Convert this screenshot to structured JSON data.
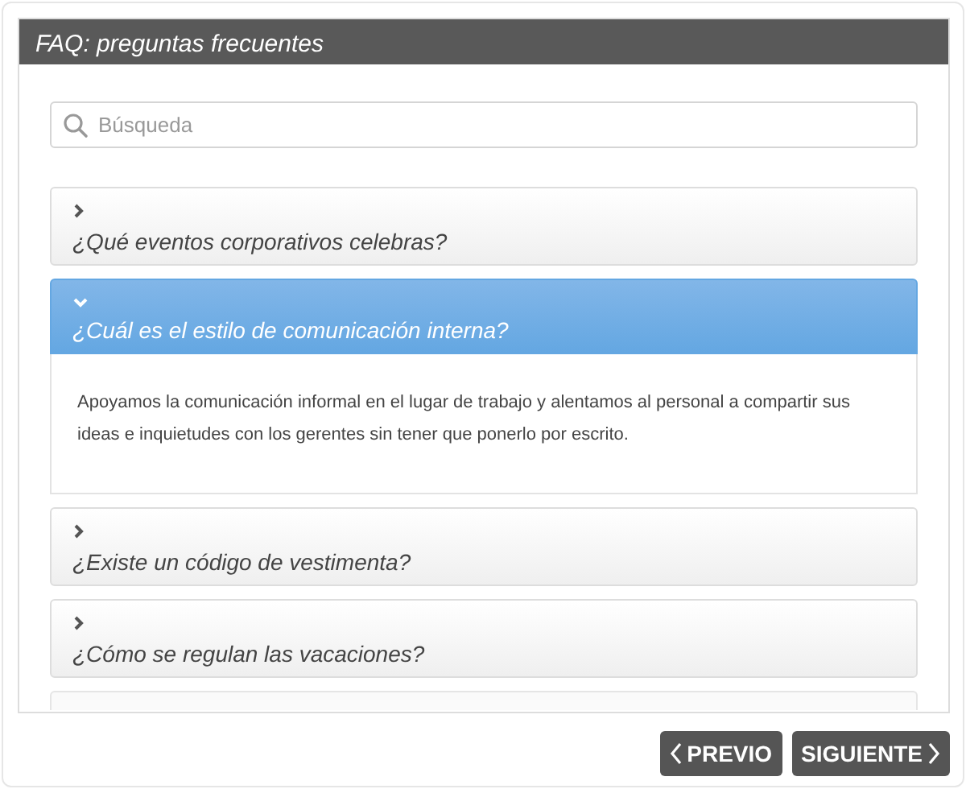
{
  "window": {
    "title": "FAQ: preguntas frecuentes"
  },
  "search": {
    "placeholder": "Búsqueda"
  },
  "faqs": [
    {
      "question": "¿Qué eventos corporativos celebras?",
      "expanded": false
    },
    {
      "question": "¿Cuál es el estilo de comunicación interna?",
      "expanded": true,
      "answer": "Apoyamos la comunicación informal en el lugar de trabajo y alentamos al personal a compartir sus ideas e inquietudes con los gerentes sin tener que ponerlo por escrito."
    },
    {
      "question": "¿Existe un código de vestimenta?",
      "expanded": false
    },
    {
      "question": "¿Cómo se regulan las vacaciones?",
      "expanded": false
    }
  ],
  "buttons": [
    {
      "label": "PREVIO",
      "kind": "prev"
    },
    {
      "label": "SIGUIENTE",
      "kind": "next"
    }
  ]
}
